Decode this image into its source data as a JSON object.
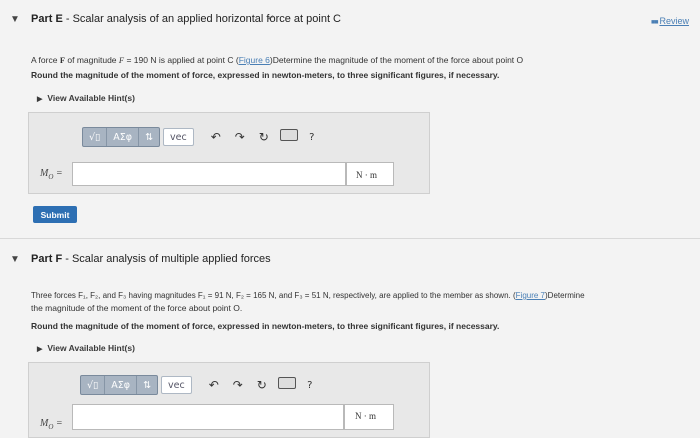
{
  "partE": {
    "caret": "▼",
    "title_prefix": "Part E",
    "title_rest": " - Scalar analysis of an applied horizontal force at point C",
    "review": "Review",
    "desc_a": "A force ",
    "desc_F": "F",
    "desc_b": " of magnitude ",
    "desc_F2": "F",
    "desc_c": " = 190 N is applied at point C (",
    "desc_link": "Figure 6",
    "desc_d": ")Determine the magnitude of the moment of the force about point O",
    "round": "Round the magnitude of the moment of force, expressed in newton-meters, to three significant figures, if necessary.",
    "hint": "View Available Hint(s)",
    "answer_label": "M",
    "answer_sub": "O",
    "answer_eq": " =",
    "unit": "N · m",
    "submit": "Submit"
  },
  "partF": {
    "caret": "▼",
    "title_prefix": "Part F",
    "title_rest": " - Scalar analysis of multiple applied forces",
    "desc_line1": "Three forces F₁, F₂, and F₃ having magnitudes F₁ = 91 N, F₂ = 165 N, and F₃ = 51 N, respectively, are applied to the member as shown. (",
    "desc_link": "Figure 7",
    "desc_line1_end": ")Determine",
    "desc_line2": "the magnitude of the moment of the force about point O.",
    "round": "Round the magnitude of the moment of force, expressed in newton-meters, to three significant figures, if necessary.",
    "hint": "View Available Hint(s)",
    "answer_label": "M",
    "answer_sub": "O",
    "answer_eq": " =",
    "unit": "N · m"
  },
  "toolbar": {
    "templates": "√▯",
    "greek": "ΑΣφ",
    "arrows": "⇅",
    "vec": "vec",
    "undo": "↶",
    "redo": "↷",
    "reset": "↻",
    "help": "?"
  }
}
